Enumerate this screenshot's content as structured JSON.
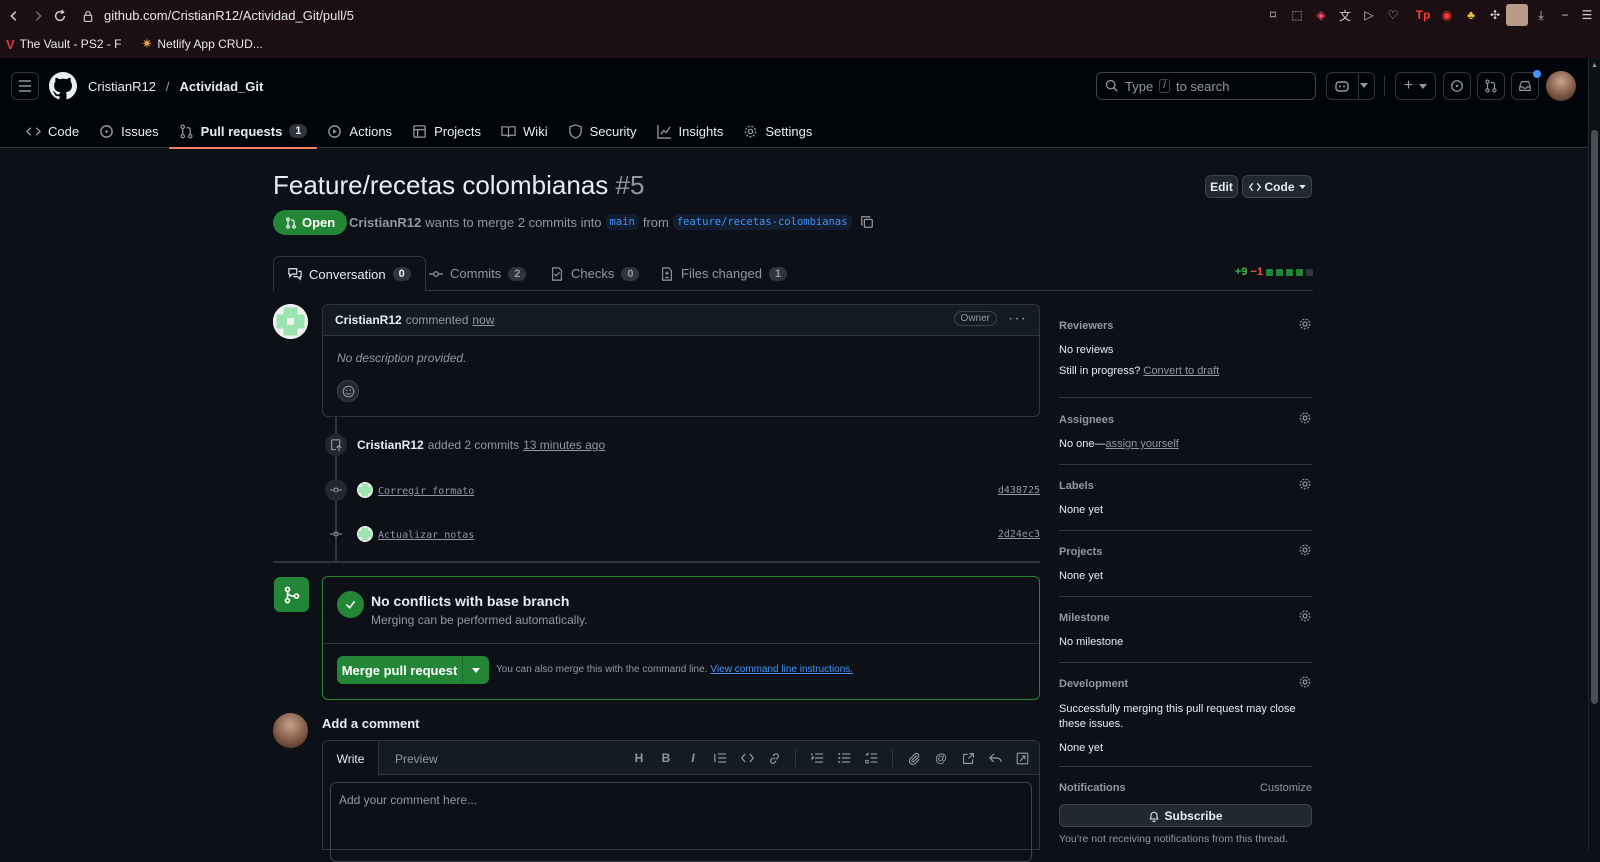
{
  "browser": {
    "url": "github.com/CristianR12/Actividad_Git/pull/5",
    "bookmarks": [
      {
        "label": "The Vault - PS2 - F"
      },
      {
        "label": "Netlify App CRUD..."
      }
    ]
  },
  "header": {
    "owner": "CristianR12",
    "separator": "/",
    "repo": "Actividad_Git",
    "search_placeholder_prefix": "Type",
    "search_key": "/",
    "search_placeholder_suffix": "to search"
  },
  "repo_nav": [
    {
      "label": "Code",
      "icon": "code-icon"
    },
    {
      "label": "Issues",
      "icon": "issue-icon"
    },
    {
      "label": "Pull requests",
      "icon": "pull-request-icon",
      "count": "1",
      "active": true
    },
    {
      "label": "Actions",
      "icon": "play-icon"
    },
    {
      "label": "Projects",
      "icon": "table-icon"
    },
    {
      "label": "Wiki",
      "icon": "book-icon"
    },
    {
      "label": "Security",
      "icon": "shield-icon"
    },
    {
      "label": "Insights",
      "icon": "graph-icon"
    },
    {
      "label": "Settings",
      "icon": "gear-icon"
    }
  ],
  "pr": {
    "title": "Feature/recetas colombianas",
    "number": "#5",
    "edit_label": "Edit",
    "code_label": "Code",
    "state": "Open",
    "author": "CristianR12",
    "merge_text_1": "wants to merge 2 commits into",
    "base_branch": "main",
    "merge_text_2": "from",
    "head_branch": "feature/recetas-colombianas"
  },
  "tabs": [
    {
      "label": "Conversation",
      "count": "0",
      "active": true
    },
    {
      "label": "Commits",
      "count": "2"
    },
    {
      "label": "Checks",
      "count": "0"
    },
    {
      "label": "Files changed",
      "count": "1"
    }
  ],
  "diffstat": {
    "additions": "+9",
    "deletions": "−1",
    "colors": [
      "#238636",
      "#238636",
      "#238636",
      "#238636",
      "#30363d"
    ]
  },
  "comment": {
    "author": "CristianR12",
    "action": "commented",
    "time": "now",
    "badge": "Owner",
    "body": "No description provided."
  },
  "commits_event": {
    "author": "CristianR12",
    "action": "added 2 commits",
    "time": "13 minutes ago",
    "commits": [
      {
        "message": "Corregir formato",
        "sha": "d438725"
      },
      {
        "message": "Actualizar notas",
        "sha": "2d24ec3"
      }
    ]
  },
  "merge": {
    "title": "No conflicts with base branch",
    "subtitle": "Merging can be performed automatically.",
    "button": "Merge pull request",
    "hint": "You can also merge this with the command line.",
    "link": "View command line instructions."
  },
  "add_comment": {
    "title": "Add a comment",
    "write_tab": "Write",
    "preview_tab": "Preview",
    "placeholder": "Add your comment here...",
    "heading_tool": "H",
    "bold_tool": "B",
    "italic_tool": "I"
  },
  "sidebar": {
    "reviewers": {
      "title": "Reviewers",
      "value": "No reviews",
      "progress_text": "Still in progress?",
      "progress_link": "Convert to draft"
    },
    "assignees": {
      "title": "Assignees",
      "value": "No one—",
      "link": "assign yourself"
    },
    "labels": {
      "title": "Labels",
      "value": "None yet"
    },
    "projects": {
      "title": "Projects",
      "value": "None yet"
    },
    "milestone": {
      "title": "Milestone",
      "value": "No milestone"
    },
    "development": {
      "title": "Development",
      "note": "Successfully merging this pull request may close these issues.",
      "value": "None yet"
    },
    "notifications": {
      "title": "Notifications",
      "customize": "Customize",
      "subscribe": "Subscribe",
      "note": "You’re not receiving notifications from this thread."
    }
  }
}
